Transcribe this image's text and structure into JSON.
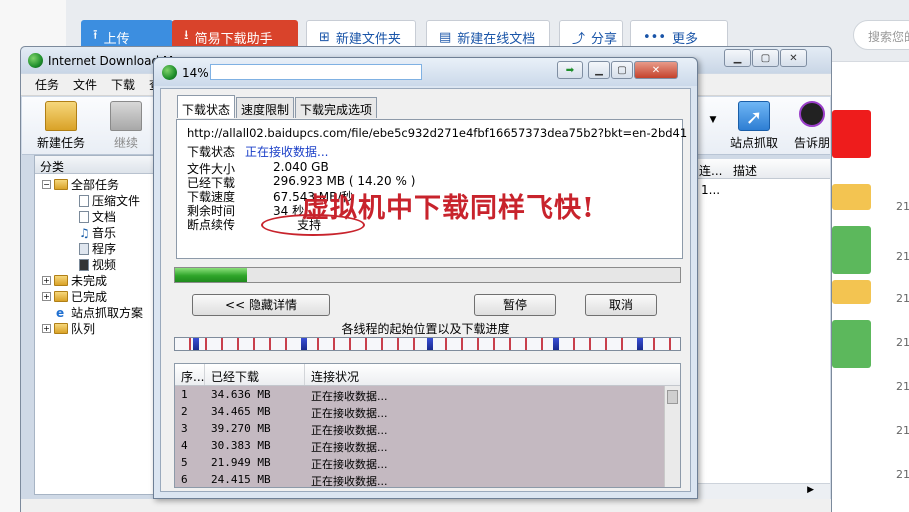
{
  "background": {
    "buttons": [
      {
        "label": "上传",
        "style": "blue"
      },
      {
        "label": "简易下载助手",
        "style": "red"
      },
      {
        "label": "新建文件夹",
        "style": "white"
      },
      {
        "label": "新建在线文档",
        "style": "white"
      },
      {
        "label": "分享",
        "style": "white"
      },
      {
        "label": "更多",
        "style": "white"
      }
    ],
    "search_placeholder": "搜索您的",
    "side_numbers": [
      "21",
      "21",
      "21",
      "21",
      "21",
      "21",
      "21"
    ],
    "block_colors": [
      "#ee1c1c",
      "#f3c451",
      "#5cb85c",
      "#f3c451",
      "#5cb85c"
    ]
  },
  "idm": {
    "title": "Internet Download M",
    "menu": [
      "任务",
      "文件",
      "下载",
      "查"
    ],
    "toolbar": {
      "new_task": "新建任务",
      "resume": "继续",
      "site_grab": "站点抓取",
      "tell": "告诉朋"
    },
    "category_header": "分类",
    "tree": {
      "all": "全部任务",
      "compressed": "压缩文件",
      "documents": "文档",
      "music": "音乐",
      "programs": "程序",
      "video": "视频",
      "unfinished": "未完成",
      "finished": "已完成",
      "grabber": "站点抓取方案",
      "queues": "队列"
    },
    "list_header": {
      "col1": "连...",
      "col2": "描述"
    },
    "list_row": {
      "col1": "1..."
    }
  },
  "dialog": {
    "percent": "14%",
    "tabs": [
      "下载状态",
      "速度限制",
      "下载完成选项"
    ],
    "url": "http://allall02.baidupcs.com/file/ebe5c932d271e4fbf16657373dea75b2?bkt=en-2bd41",
    "status_label": "下载状态",
    "status_value": "正在接收数据...",
    "file_size_label": "文件大小",
    "file_size": "2.040  GB",
    "downloaded_label": "已经下载",
    "downloaded": "296.923  MB  ( 14.20 % )",
    "speed_label": "下载速度",
    "speed": "67.543  MB/秒",
    "remaining_label": "剩余时间",
    "remaining": "34 秒",
    "resume_label": "断点续传",
    "resume_value": "支持",
    "annotation": "虚拟机中下载同样飞快!",
    "progress": 0.142,
    "hide_details": "<< 隐藏详情",
    "pause": "暂停",
    "cancel": "取消",
    "threads_caption": "各线程的起始位置以及下载进度",
    "thread_columns": [
      "序...",
      "已经下载",
      "连接状况"
    ],
    "threads": [
      {
        "no": "1",
        "downloaded": "34.636  MB",
        "status": "正在接收数据..."
      },
      {
        "no": "2",
        "downloaded": "34.465  MB",
        "status": "正在接收数据..."
      },
      {
        "no": "3",
        "downloaded": "39.270  MB",
        "status": "正在接收数据..."
      },
      {
        "no": "4",
        "downloaded": "30.383  MB",
        "status": "正在接收数据..."
      },
      {
        "no": "5",
        "downloaded": "21.949  MB",
        "status": "正在接收数据..."
      },
      {
        "no": "6",
        "downloaded": "24.415  MB",
        "status": "正在接收数据..."
      }
    ]
  }
}
